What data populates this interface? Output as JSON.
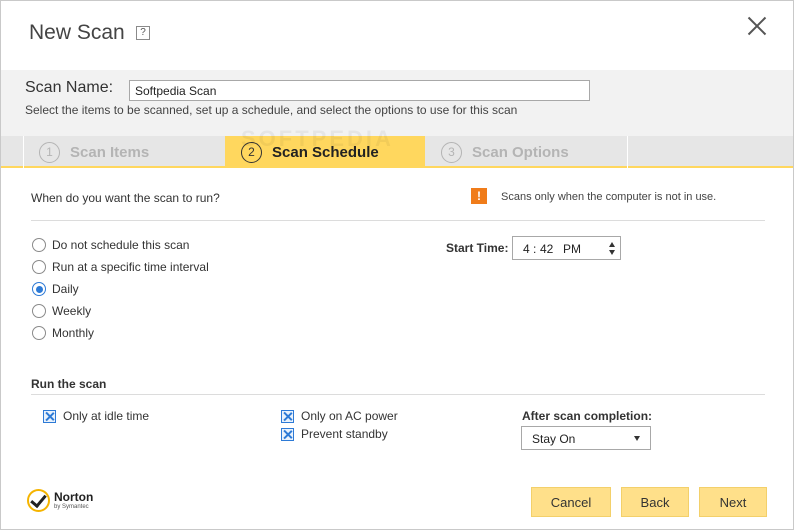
{
  "window": {
    "title": "New Scan",
    "help_label": "?"
  },
  "header": {
    "scan_name_label": "Scan Name:",
    "scan_name_value": "Softpedia Scan",
    "subtitle": "Select the items to be scanned, set up a schedule, and select the options to use for this scan"
  },
  "tabs": [
    {
      "number": "1",
      "label": "Scan Items",
      "active": false
    },
    {
      "number": "2",
      "label": "Scan Schedule",
      "active": true
    },
    {
      "number": "3",
      "label": "Scan Options",
      "active": false
    }
  ],
  "watermark": "SOFTPEDIA",
  "schedule": {
    "question": "When do you want the scan to run?",
    "notice": "Scans only when the computer is not in use.",
    "options": [
      {
        "label": "Do not schedule this scan",
        "selected": false
      },
      {
        "label": "Run at a specific time interval",
        "selected": false
      },
      {
        "label": "Daily",
        "selected": true
      },
      {
        "label": "Weekly",
        "selected": false
      },
      {
        "label": "Monthly",
        "selected": false
      }
    ],
    "start_time_label": "Start Time:",
    "start_time": {
      "hour": "4",
      "separator": ":",
      "minute": "42",
      "ampm": "PM"
    }
  },
  "run_the_scan": {
    "title": "Run the scan",
    "checks": [
      {
        "label": "Only at idle time",
        "checked": true
      },
      {
        "label": "Only on AC power",
        "checked": true
      },
      {
        "label": "Prevent standby",
        "checked": true
      }
    ],
    "after_completion_label": "After scan completion:",
    "after_completion_value": "Stay On"
  },
  "logo": {
    "name": "Norton",
    "sub": "by Symantec"
  },
  "footer": {
    "cancel_label": "Cancel",
    "back_label": "Back",
    "next_label": "Next"
  },
  "colors": {
    "accent": "#ffd75e",
    "button": "#ffe08a",
    "radio": "#2d7ad6",
    "warning": "#f07c1a"
  }
}
